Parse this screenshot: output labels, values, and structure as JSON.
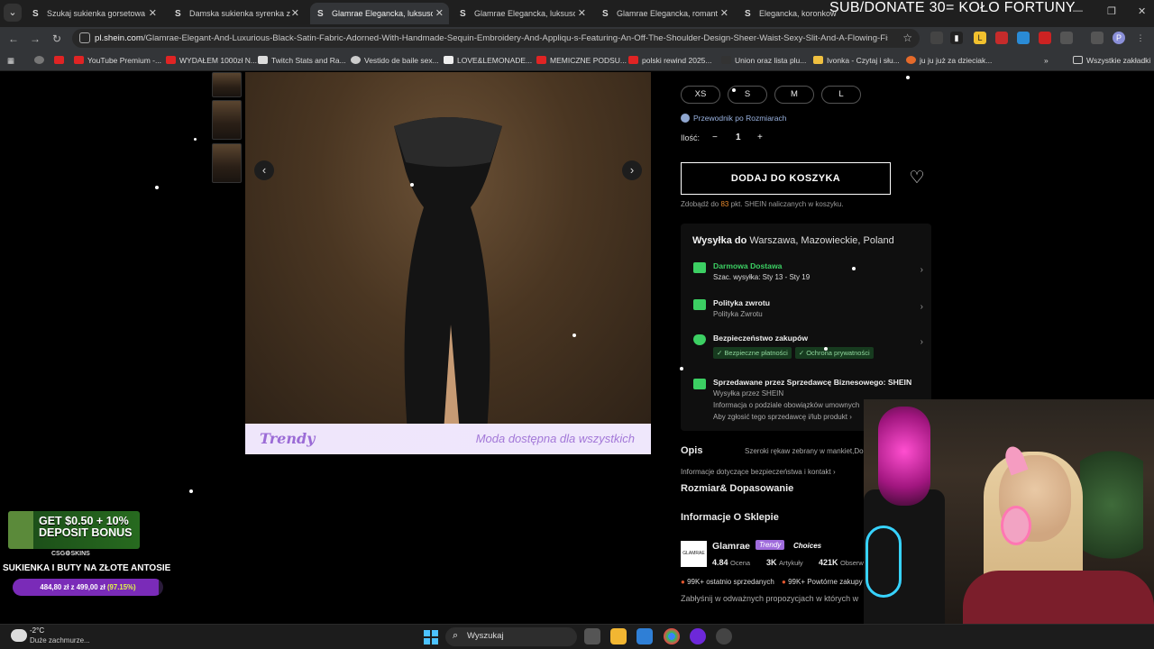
{
  "browser": {
    "tabs": [
      {
        "icon": "S",
        "title": "Szukaj sukienka gorsetowa | SH",
        "active": false
      },
      {
        "icon": "S",
        "title": "Damska sukienka syrenka z głę",
        "active": false
      },
      {
        "icon": "S",
        "title": "Glamrae Elegancka, luksusowa",
        "active": true
      },
      {
        "icon": "S",
        "title": "Glamrae Elegancka, luksusowa",
        "active": false
      },
      {
        "icon": "S",
        "title": "Glamrae Elegancka, romantycz",
        "active": false
      },
      {
        "icon": "S",
        "title": "Elegancka, koronkowa,",
        "active": false
      }
    ],
    "url_domain": "pl.shein.com",
    "url_path": "/Glamrae-Elegant-And-Luxurious-Black-Satin-Fabric-Adorned-With-Handmade-Sequin-Embroidery-And-Appliqu-s-Featuring-An-Off-The-Shoulder-Design-Sheer-Waist-Sexy-Slit-And-A-Flowing-Fishtai...",
    "bookmarks": [
      {
        "label": "",
        "color": "#888888"
      },
      {
        "label": "",
        "color": "#e02424"
      },
      {
        "label": "YouTube Premium -...",
        "color": "#e02424"
      },
      {
        "label": "WYDAŁEM 1000zł N...",
        "color": "#e02424"
      },
      {
        "label": "Twitch Stats and Ra...",
        "color": "#dcdcdc"
      },
      {
        "label": "Vestido de baile sex...",
        "color": "#dcdcdc"
      },
      {
        "label": "LOVE&LEMONADE...",
        "color": "#dcdcdc"
      },
      {
        "label": "MEMICZNE PODSU...",
        "color": "#e02424"
      },
      {
        "label": "polski rewind 2025...",
        "color": "#e02424"
      },
      {
        "label": "Union oraz lista plu...",
        "color": "#dcdcdc"
      },
      {
        "label": "Ivonka - Czytaj i słu...",
        "color": "#f0c040"
      },
      {
        "label": "ju ju już za dzieciak...",
        "color": "#e56a2a"
      }
    ],
    "bookmarks_other": "Wszystkie zakładki"
  },
  "stream": {
    "banner": "SUB/DONATE 30= KOŁO FORTUNY",
    "promo_line1": "GET $0.50 + 10%",
    "promo_line2": "DEPOSIT BONUS",
    "promo_brand": "CSG⚙SKINS",
    "goal_title": "SUKIENKA I BUTY NA ZŁOTE ANTOSIE",
    "goal_amount": "484,80 zł z 499,00 zł",
    "goal_percent_text": "(97.15%)",
    "goal_fraction": 0.9715
  },
  "product": {
    "sizes": [
      "XS",
      "S",
      "M",
      "L"
    ],
    "size_guide": "Przewodnik po Rozmiarach",
    "qty_label": "Ilość:",
    "qty_minus": "−",
    "qty_value": "1",
    "qty_plus": "+",
    "add_to_cart": "DODAJ DO KOSZYKA",
    "points_pre": "Zdobądź do ",
    "points_value": "83",
    "points_post": " pkt. SHEIN naliczanych w koszyku.",
    "banner_logo": "Trendy",
    "banner_tagline": "Moda dostępna dla wszystkich",
    "prev": "‹",
    "next": "›"
  },
  "shipping": {
    "title_pre": "Wysyłka do ",
    "title_place": "Warszawa, Mazowieckie, Poland",
    "free_title": "Darmowa Dostawa",
    "free_sub": "Szac. wysyłka: Sty 13 - Sty 19",
    "returns_title": "Polityka zwrotu",
    "returns_sub": "Polityka Zwrotu",
    "security_title": "Bezpieczeństwo zakupów",
    "security_pill1": "✓ Bezpieczne płatności",
    "security_pill2": "✓ Ochrona prywatności",
    "seller_title": "Sprzedawane przez Sprzedawcę Biznesowego: SHEIN",
    "seller_l1": "Wysyłka przez SHEIN",
    "seller_l2": "Informacja o podziale obowiązków umownych",
    "seller_l3": "Aby zgłosić tego sprzedawcę i/lub produkt ›"
  },
  "details": {
    "opis": "Opis",
    "opis_desc": "Szeroki rękaw zebrany w mankiet,Dop",
    "safety": "Informacje dotyczące bezpieczeństwa i kontakt ›",
    "fit": "Rozmiar& Dopasowanie",
    "store_info": "Informacje O Sklepie",
    "store_logo_text": "GLAMRAE",
    "store_name": "Glamrae",
    "badge_trendy": "Trendy",
    "badge_choices": "Choices",
    "rating": "4.84",
    "rating_label": "Ocena",
    "articles": "3K",
    "articles_label": "Artykuły",
    "followers": "421K",
    "followers_label": "Obserw",
    "sold_recent": "99K+ ostatnio sprzedanych",
    "repeat": "99K+ Powtórne zakupy",
    "bottom_text": "Zabłyśnij w odważnych propozycjach w których w"
  },
  "taskbar": {
    "temp": "-2°C",
    "weather": "Duże zachmurze...",
    "search": "Wyszukaj"
  },
  "colors": {
    "accent_green": "#3ccf63",
    "points_orange": "#e98a2c",
    "trendy_purple": "#9b6bd6",
    "goal_purple": "#7a2bb8"
  }
}
